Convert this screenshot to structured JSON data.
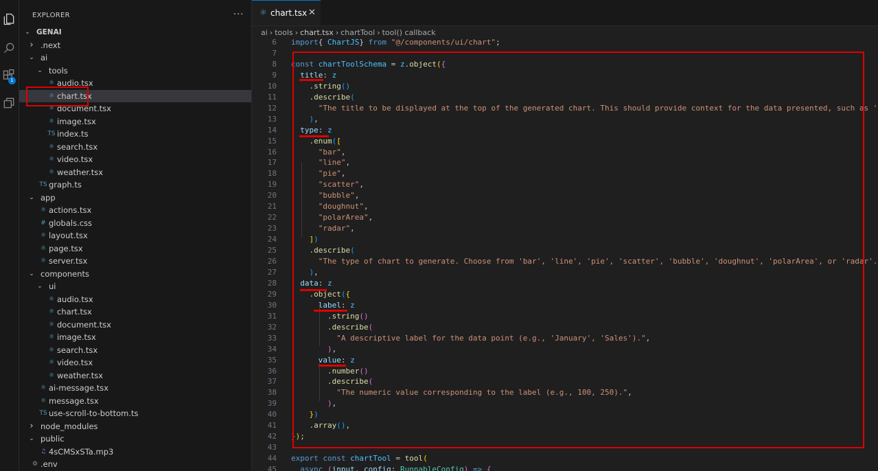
{
  "sidebar": {
    "title": "EXPLORER",
    "more": "···",
    "tree": [
      {
        "label": "GENAI",
        "depth": 0,
        "kind": "root",
        "open": true
      },
      {
        "label": ".next",
        "depth": 1,
        "kind": "folder",
        "open": false
      },
      {
        "label": "ai",
        "depth": 1,
        "kind": "folder",
        "open": true
      },
      {
        "label": "tools",
        "depth": 2,
        "kind": "folder",
        "open": true
      },
      {
        "label": "audio.tsx",
        "depth": 3,
        "kind": "react"
      },
      {
        "label": "chart.tsx",
        "depth": 3,
        "kind": "react",
        "selected": true
      },
      {
        "label": "document.tsx",
        "depth": 3,
        "kind": "react"
      },
      {
        "label": "image.tsx",
        "depth": 3,
        "kind": "react"
      },
      {
        "label": "index.ts",
        "depth": 3,
        "kind": "ts"
      },
      {
        "label": "search.tsx",
        "depth": 3,
        "kind": "react"
      },
      {
        "label": "video.tsx",
        "depth": 3,
        "kind": "react"
      },
      {
        "label": "weather.tsx",
        "depth": 3,
        "kind": "react"
      },
      {
        "label": "graph.ts",
        "depth": 2,
        "kind": "ts"
      },
      {
        "label": "app",
        "depth": 1,
        "kind": "folder",
        "open": true
      },
      {
        "label": "actions.tsx",
        "depth": 2,
        "kind": "react"
      },
      {
        "label": "globals.css",
        "depth": 2,
        "kind": "css"
      },
      {
        "label": "layout.tsx",
        "depth": 2,
        "kind": "react"
      },
      {
        "label": "page.tsx",
        "depth": 2,
        "kind": "react"
      },
      {
        "label": "server.tsx",
        "depth": 2,
        "kind": "react"
      },
      {
        "label": "components",
        "depth": 1,
        "kind": "folder",
        "open": true
      },
      {
        "label": "ui",
        "depth": 2,
        "kind": "folder",
        "open": true
      },
      {
        "label": "audio.tsx",
        "depth": 3,
        "kind": "react"
      },
      {
        "label": "chart.tsx",
        "depth": 3,
        "kind": "react"
      },
      {
        "label": "document.tsx",
        "depth": 3,
        "kind": "react"
      },
      {
        "label": "image.tsx",
        "depth": 3,
        "kind": "react"
      },
      {
        "label": "search.tsx",
        "depth": 3,
        "kind": "react"
      },
      {
        "label": "video.tsx",
        "depth": 3,
        "kind": "react"
      },
      {
        "label": "weather.tsx",
        "depth": 3,
        "kind": "react"
      },
      {
        "label": "ai-message.tsx",
        "depth": 2,
        "kind": "react"
      },
      {
        "label": "message.tsx",
        "depth": 2,
        "kind": "react"
      },
      {
        "label": "use-scroll-to-bottom.ts",
        "depth": 2,
        "kind": "ts"
      },
      {
        "label": "node_modules",
        "depth": 1,
        "kind": "folder",
        "open": false
      },
      {
        "label": "public",
        "depth": 1,
        "kind": "folder",
        "open": true
      },
      {
        "label": "4sCMSxSTa.mp3",
        "depth": 2,
        "kind": "audio"
      },
      {
        "label": ".env",
        "depth": 1,
        "kind": "gear"
      }
    ],
    "file_icons": {
      "react": "⚛",
      "ts": "TS",
      "css": "#",
      "audio": "♫",
      "gear": "⚙"
    },
    "icon_colors": {
      "react": "#519aba",
      "ts": "#519aba",
      "css": "#519aba",
      "audio": "#a074c4",
      "gear": "#8e8e8e"
    }
  },
  "tab": {
    "label": "chart.tsx",
    "close": "✕",
    "icon": "react-icon"
  },
  "breadcrumb": [
    "ai",
    "›",
    "tools",
    "›",
    "chart.tsx",
    "›",
    "chartTool",
    "›",
    "tool() callback"
  ],
  "editor": {
    "lines": [
      {
        "n": "6",
        "tokens": [
          [
            "k",
            "import"
          ],
          [
            "",
            "{ "
          ],
          [
            "v",
            "ChartJS"
          ],
          [
            "",
            "} "
          ],
          [
            "k",
            "from"
          ],
          [
            "s",
            " \"@/components/ui/chart\""
          ],
          [
            "",
            ";"
          ]
        ]
      },
      {
        "n": "7",
        "tokens": []
      },
      {
        "n": "8",
        "tokens": [
          [
            "k",
            "const"
          ],
          [
            "",
            " "
          ],
          [
            "v",
            "chartToolSchema"
          ],
          [
            "",
            " = "
          ],
          [
            "v",
            "z"
          ],
          [
            "",
            "."
          ],
          [
            "f",
            "object"
          ],
          [
            "b1",
            "("
          ],
          [
            "b2",
            "{"
          ]
        ]
      },
      {
        "n": "9",
        "tokens": [
          [
            "",
            "  "
          ],
          [
            "p",
            "title"
          ],
          [
            "",
            ": "
          ],
          [
            "v",
            "z"
          ]
        ]
      },
      {
        "n": "10",
        "tokens": [
          [
            "",
            "    ."
          ],
          [
            "f",
            "string"
          ],
          [
            "b3",
            "()"
          ]
        ]
      },
      {
        "n": "11",
        "tokens": [
          [
            "",
            "    ."
          ],
          [
            "f",
            "describe"
          ],
          [
            "b3",
            "("
          ]
        ]
      },
      {
        "n": "12",
        "tokens": [
          [
            "",
            "      "
          ],
          [
            "s",
            "\"The title to be displayed at the top of the generated chart. This should provide context for the data presented, such as 'Sale"
          ]
        ]
      },
      {
        "n": "13",
        "tokens": [
          [
            "",
            "    "
          ],
          [
            "b3",
            ")"
          ],
          [
            "",
            ","
          ]
        ]
      },
      {
        "n": "14",
        "tokens": [
          [
            "",
            "  "
          ],
          [
            "p",
            "type"
          ],
          [
            "",
            ": "
          ],
          [
            "v",
            "z"
          ]
        ]
      },
      {
        "n": "15",
        "tokens": [
          [
            "",
            "    ."
          ],
          [
            "f",
            "enum"
          ],
          [
            "b3",
            "("
          ],
          [
            "b1",
            "["
          ]
        ]
      },
      {
        "n": "16",
        "tokens": [
          [
            "",
            "      "
          ],
          [
            "s",
            "\"bar\""
          ],
          [
            "",
            ","
          ]
        ]
      },
      {
        "n": "17",
        "tokens": [
          [
            "",
            "      "
          ],
          [
            "s",
            "\"line\""
          ],
          [
            "",
            ","
          ]
        ]
      },
      {
        "n": "18",
        "tokens": [
          [
            "",
            "      "
          ],
          [
            "s",
            "\"pie\""
          ],
          [
            "",
            ","
          ]
        ]
      },
      {
        "n": "19",
        "tokens": [
          [
            "",
            "      "
          ],
          [
            "s",
            "\"scatter\""
          ],
          [
            "",
            ","
          ]
        ]
      },
      {
        "n": "20",
        "tokens": [
          [
            "",
            "      "
          ],
          [
            "s",
            "\"bubble\""
          ],
          [
            "",
            ","
          ]
        ]
      },
      {
        "n": "21",
        "tokens": [
          [
            "",
            "      "
          ],
          [
            "s",
            "\"doughnut\""
          ],
          [
            "",
            ","
          ]
        ]
      },
      {
        "n": "22",
        "tokens": [
          [
            "",
            "      "
          ],
          [
            "s",
            "\"polarArea\""
          ],
          [
            "",
            ","
          ]
        ]
      },
      {
        "n": "23",
        "tokens": [
          [
            "",
            "      "
          ],
          [
            "s",
            "\"radar\""
          ],
          [
            "",
            ","
          ]
        ]
      },
      {
        "n": "24",
        "tokens": [
          [
            "",
            "    "
          ],
          [
            "b1",
            "]"
          ],
          [
            "b3",
            ")"
          ]
        ]
      },
      {
        "n": "25",
        "tokens": [
          [
            "",
            "    ."
          ],
          [
            "f",
            "describe"
          ],
          [
            "b3",
            "("
          ]
        ]
      },
      {
        "n": "26",
        "tokens": [
          [
            "",
            "      "
          ],
          [
            "s",
            "\"The type of chart to generate. Choose from 'bar', 'line', 'pie', 'scatter', 'bubble', 'doughnut', 'polarArea', or 'radar'.\""
          ],
          [
            "",
            ","
          ]
        ]
      },
      {
        "n": "27",
        "tokens": [
          [
            "",
            "    "
          ],
          [
            "b3",
            ")"
          ],
          [
            "",
            ","
          ]
        ]
      },
      {
        "n": "28",
        "tokens": [
          [
            "",
            "  "
          ],
          [
            "p",
            "data"
          ],
          [
            "",
            ": "
          ],
          [
            "v",
            "z"
          ]
        ]
      },
      {
        "n": "29",
        "tokens": [
          [
            "",
            "    ."
          ],
          [
            "f",
            "object"
          ],
          [
            "b3",
            "("
          ],
          [
            "b1",
            "{"
          ]
        ]
      },
      {
        "n": "30",
        "tokens": [
          [
            "",
            "      "
          ],
          [
            "p",
            "label"
          ],
          [
            "",
            ": "
          ],
          [
            "v",
            "z"
          ]
        ]
      },
      {
        "n": "31",
        "tokens": [
          [
            "",
            "        ."
          ],
          [
            "f",
            "string"
          ],
          [
            "b2",
            "()"
          ]
        ]
      },
      {
        "n": "32",
        "tokens": [
          [
            "",
            "        ."
          ],
          [
            "f",
            "describe"
          ],
          [
            "b2",
            "("
          ]
        ]
      },
      {
        "n": "33",
        "tokens": [
          [
            "",
            "          "
          ],
          [
            "s",
            "\"A descriptive label for the data point (e.g., 'January', 'Sales').\""
          ],
          [
            "",
            ","
          ]
        ]
      },
      {
        "n": "34",
        "tokens": [
          [
            "",
            "        "
          ],
          [
            "b2",
            ")"
          ],
          [
            "",
            ","
          ]
        ]
      },
      {
        "n": "35",
        "tokens": [
          [
            "",
            "      "
          ],
          [
            "p",
            "value"
          ],
          [
            "",
            ": "
          ],
          [
            "v",
            "z"
          ]
        ]
      },
      {
        "n": "36",
        "tokens": [
          [
            "",
            "        ."
          ],
          [
            "f",
            "number"
          ],
          [
            "b2",
            "()"
          ]
        ]
      },
      {
        "n": "37",
        "tokens": [
          [
            "",
            "        ."
          ],
          [
            "f",
            "describe"
          ],
          [
            "b2",
            "("
          ]
        ]
      },
      {
        "n": "38",
        "tokens": [
          [
            "",
            "          "
          ],
          [
            "s",
            "\"The numeric value corresponding to the label (e.g., 100, 250).\""
          ],
          [
            "",
            ","
          ]
        ]
      },
      {
        "n": "39",
        "tokens": [
          [
            "",
            "        "
          ],
          [
            "b2",
            ")"
          ],
          [
            "",
            ","
          ]
        ]
      },
      {
        "n": "40",
        "tokens": [
          [
            "",
            "    "
          ],
          [
            "b1",
            "}"
          ],
          [
            "b3",
            ")"
          ]
        ]
      },
      {
        "n": "41",
        "tokens": [
          [
            "",
            "    ."
          ],
          [
            "f",
            "array"
          ],
          [
            "b3",
            "()"
          ],
          [
            "",
            ","
          ]
        ]
      },
      {
        "n": "42",
        "tokens": [
          [
            "b2",
            "}"
          ],
          [
            "b1",
            ")"
          ],
          [
            "",
            ";"
          ]
        ]
      },
      {
        "n": "43",
        "tokens": []
      },
      {
        "n": "44",
        "tokens": [
          [
            "k",
            "export"
          ],
          [
            "",
            " "
          ],
          [
            "k",
            "const"
          ],
          [
            "",
            " "
          ],
          [
            "v",
            "chartTool"
          ],
          [
            "",
            " = "
          ],
          [
            "f",
            "tool"
          ],
          [
            "b1",
            "("
          ]
        ]
      },
      {
        "n": "45",
        "tokens": [
          [
            "",
            "  "
          ],
          [
            "k",
            "async"
          ],
          [
            "",
            " "
          ],
          [
            "b2",
            "("
          ],
          [
            "p",
            "input"
          ],
          [
            "",
            ", "
          ],
          [
            "p",
            "config"
          ],
          [
            "",
            ": "
          ],
          [
            "t",
            "RunnableConfig"
          ],
          [
            "b2",
            ")"
          ],
          [
            "",
            " "
          ],
          [
            "k",
            "=>"
          ],
          [
            "",
            " "
          ],
          [
            "b2",
            "{"
          ]
        ]
      }
    ]
  }
}
